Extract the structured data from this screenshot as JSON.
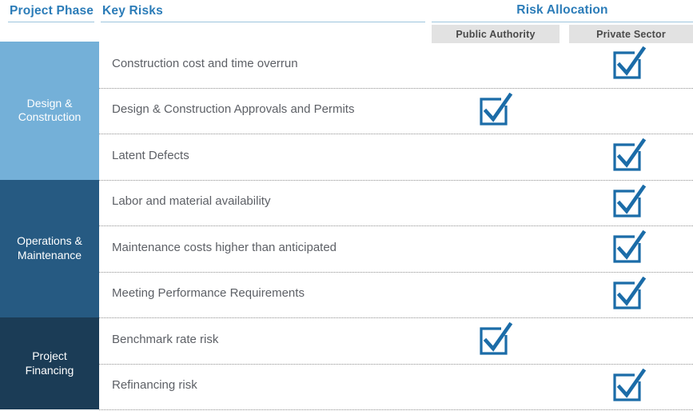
{
  "header": {
    "col_phase": "Project Phase",
    "col_risks": "Key Risks",
    "group_title": "Risk Allocation",
    "sub_public": "Public Authority",
    "sub_private": "Private Sector"
  },
  "colors": {
    "accent_blue": "#2b7cb8",
    "phase_1": "#74b0d8",
    "phase_2": "#265a82",
    "phase_3": "#1b3c56",
    "subheader_bg": "#e2e2e2",
    "check_blue": "#1b6ca8",
    "risk_text": "#5d6066",
    "divider": "#8f8f8f"
  },
  "phases": [
    {
      "label_line1": "Design &",
      "label_line2": "Construction"
    },
    {
      "label_line1": "Operations &",
      "label_line2": "Maintenance"
    },
    {
      "label_line1": "Project",
      "label_line2": "Financing"
    }
  ],
  "rows": [
    {
      "risk": "Construction cost and time overrun",
      "public": false,
      "private": true,
      "phase": 0
    },
    {
      "risk": "Design & Construction Approvals and Permits",
      "public": true,
      "private": false,
      "phase": 0
    },
    {
      "risk": "Latent Defects",
      "public": false,
      "private": true,
      "phase": 0
    },
    {
      "risk": "Labor and material availability",
      "public": false,
      "private": true,
      "phase": 1
    },
    {
      "risk": "Maintenance costs higher than anticipated",
      "public": false,
      "private": true,
      "phase": 1
    },
    {
      "risk": "Meeting Performance Requirements",
      "public": false,
      "private": true,
      "phase": 1
    },
    {
      "risk": "Benchmark rate risk",
      "public": true,
      "private": false,
      "phase": 2
    },
    {
      "risk": "Refinancing risk",
      "public": false,
      "private": true,
      "phase": 2
    }
  ],
  "icons": {
    "checked_checkbox": "checked-checkbox-icon"
  }
}
